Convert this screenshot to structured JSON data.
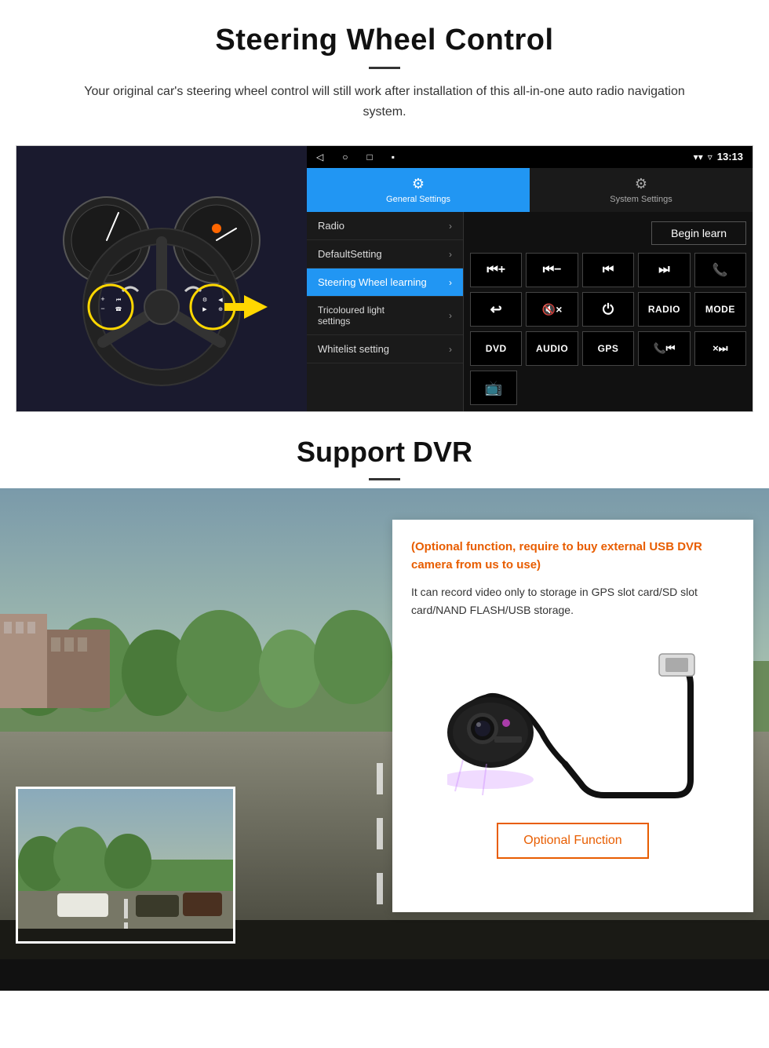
{
  "page": {
    "section1": {
      "title": "Steering Wheel Control",
      "description": "Your original car's steering wheel control will still work after installation of this all-in-one auto radio navigation system.",
      "android": {
        "status_bar": {
          "time": "13:13",
          "icons": [
            "◁",
            "○",
            "□",
            "▪"
          ]
        },
        "tabs": [
          {
            "id": "general",
            "label": "General Settings",
            "active": true
          },
          {
            "id": "system",
            "label": "System Settings",
            "active": false
          }
        ],
        "menu_items": [
          {
            "label": "Radio",
            "active": false
          },
          {
            "label": "DefaultSetting",
            "active": false
          },
          {
            "label": "Steering Wheel learning",
            "active": true
          },
          {
            "label": "Tricoloured light settings",
            "active": false
          },
          {
            "label": "Whitelist setting",
            "active": false
          }
        ],
        "begin_learn_btn": "Begin learn",
        "control_rows": [
          [
            "⏮+",
            "⏮-",
            "⏮⏮",
            "⏭⏭",
            "📞"
          ],
          [
            "↩",
            "🔇×",
            "⏻",
            "RADIO",
            "MODE"
          ],
          [
            "DVD",
            "AUDIO",
            "GPS",
            "📞⏮",
            "×⏭"
          ]
        ]
      }
    },
    "section2": {
      "title": "Support DVR",
      "divider": true,
      "card": {
        "optional_text": "(Optional function, require to buy external USB DVR camera from us to use)",
        "description": "It can record video only to storage in GPS slot card/SD slot card/NAND FLASH/USB storage.",
        "optional_btn_label": "Optional Function"
      }
    }
  }
}
